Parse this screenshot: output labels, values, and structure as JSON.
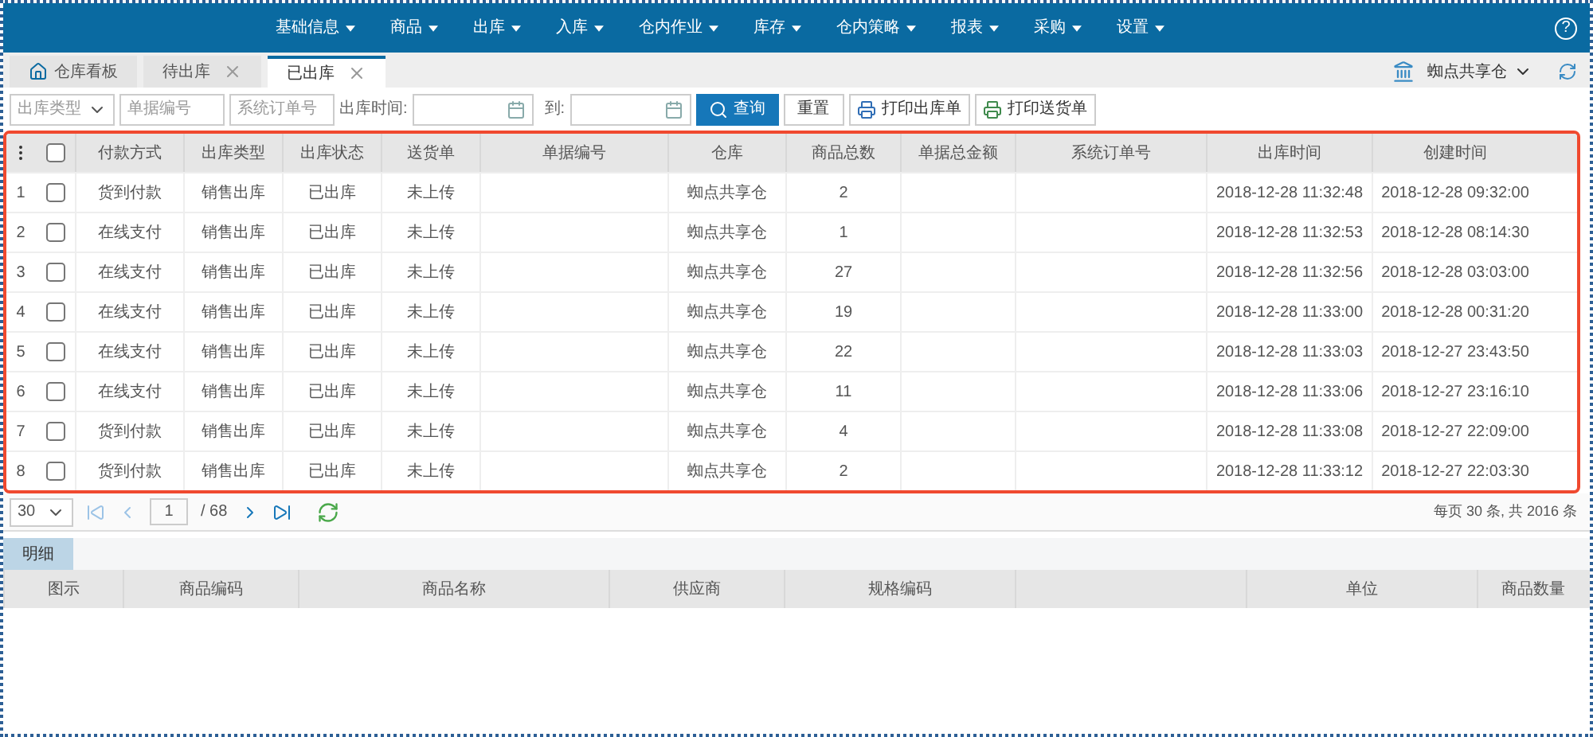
{
  "nav": {
    "items": [
      "基础信息",
      "商品",
      "出库",
      "入库",
      "仓内作业",
      "库存",
      "仓内策略",
      "报表",
      "采购",
      "设置"
    ],
    "help": "?"
  },
  "tabs": [
    {
      "label": "仓库看板",
      "kind": "home",
      "selected": false
    },
    {
      "label": "待出库",
      "kind": "closable",
      "selected": false
    },
    {
      "label": "已出库",
      "kind": "closable",
      "selected": true
    }
  ],
  "warehouse_picker": "蜘点共享仓",
  "filters": {
    "type_select": "出库类型",
    "bill_no": {
      "placeholder": "单据编号"
    },
    "order_no": {
      "placeholder": "系统订单号"
    },
    "time_label": "出库时间:",
    "to_label": "到:",
    "search": "查询",
    "reset": "重置",
    "print_out": "打印出库单",
    "print_delivery": "打印送货单"
  },
  "table": {
    "select_all_checked": false,
    "columns": [
      "付款方式",
      "出库类型",
      "出库状态",
      "送货单",
      "单据编号",
      "仓库",
      "商品总数",
      "单据总金额",
      "系统订单号",
      "出库时间",
      "创建时间"
    ],
    "rows": [
      {
        "no": "1",
        "checked": false,
        "cells": [
          "货到付款",
          "销售出库",
          "已出库",
          "未上传",
          "",
          "蜘点共享仓",
          "2",
          "",
          "",
          "2018-12-28 11:32:48",
          "2018-12-28 09:32:00"
        ]
      },
      {
        "no": "2",
        "checked": false,
        "cells": [
          "在线支付",
          "销售出库",
          "已出库",
          "未上传",
          "",
          "蜘点共享仓",
          "1",
          "",
          "",
          "2018-12-28 11:32:53",
          "2018-12-28 08:14:30"
        ]
      },
      {
        "no": "3",
        "checked": false,
        "cells": [
          "在线支付",
          "销售出库",
          "已出库",
          "未上传",
          "",
          "蜘点共享仓",
          "27",
          "",
          "",
          "2018-12-28 11:32:56",
          "2018-12-28 03:03:00"
        ]
      },
      {
        "no": "4",
        "checked": false,
        "cells": [
          "在线支付",
          "销售出库",
          "已出库",
          "未上传",
          "",
          "蜘点共享仓",
          "19",
          "",
          "",
          "2018-12-28 11:33:00",
          "2018-12-28 00:31:20"
        ]
      },
      {
        "no": "5",
        "checked": false,
        "cells": [
          "在线支付",
          "销售出库",
          "已出库",
          "未上传",
          "",
          "蜘点共享仓",
          "22",
          "",
          "",
          "2018-12-28 11:33:03",
          "2018-12-27 23:43:50"
        ]
      },
      {
        "no": "6",
        "checked": false,
        "cells": [
          "在线支付",
          "销售出库",
          "已出库",
          "未上传",
          "",
          "蜘点共享仓",
          "11",
          "",
          "",
          "2018-12-28 11:33:06",
          "2018-12-27 23:16:10"
        ]
      },
      {
        "no": "7",
        "checked": false,
        "cells": [
          "货到付款",
          "销售出库",
          "已出库",
          "未上传",
          "",
          "蜘点共享仓",
          "4",
          "",
          "",
          "2018-12-28 11:33:08",
          "2018-12-27 22:09:00"
        ]
      },
      {
        "no": "8",
        "checked": false,
        "cells": [
          "货到付款",
          "销售出库",
          "已出库",
          "未上传",
          "",
          "蜘点共享仓",
          "2",
          "",
          "",
          "2018-12-28 11:33:12",
          "2018-12-27 22:03:30"
        ]
      }
    ]
  },
  "pager": {
    "page_size": "30",
    "page": "1",
    "total_pages": "/ 68",
    "summary": "每页 30 条, 共 2016 条"
  },
  "detail": {
    "tab": "明细",
    "columns": [
      "图示",
      "商品编码",
      "商品名称",
      "供应商",
      "规格编码",
      "",
      "单位",
      "商品数量"
    ]
  }
}
